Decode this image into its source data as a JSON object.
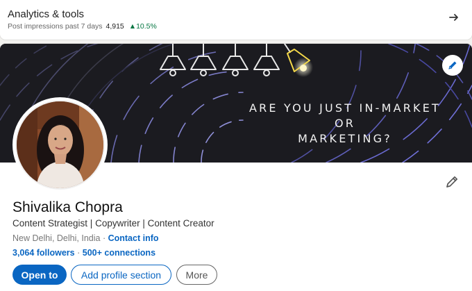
{
  "analytics": {
    "title": "Analytics & tools",
    "subtitle": "Post impressions past 7 days",
    "count": "4,915",
    "trend": "▲10.5%",
    "arrow_icon": "arrow-right-icon"
  },
  "banner": {
    "line1": "ARE YOU JUST IN-MARKET",
    "line2": "OR",
    "line3": "MARKETING?",
    "edit_icon": "pencil-icon"
  },
  "profile": {
    "name": "Shivalika Chopra",
    "headline": "Content Strategist | Copywriter | Content Creator",
    "location": "New Delhi, Delhi, India",
    "separator": "·",
    "contact_info": "Contact info",
    "followers": "3,064 followers",
    "dot": "·",
    "connections": "500+ connections"
  },
  "actions": {
    "open_to": "Open to",
    "add_section": "Add profile section",
    "more": "More"
  },
  "colors": {
    "accent": "#0a66c2",
    "trend_up": "#057642",
    "banner_bg": "#1e1e22"
  }
}
